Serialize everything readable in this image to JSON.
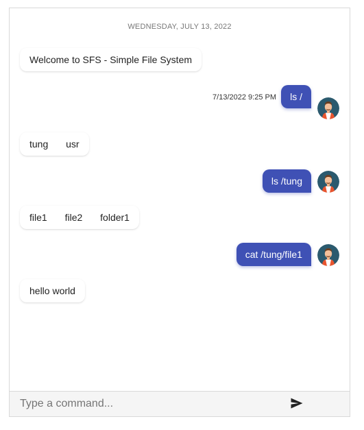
{
  "chat": {
    "date_divider": "WEDNESDAY, JULY 13, 2022",
    "messages": [
      {
        "direction": "incoming",
        "tokens": [
          "Welcome to SFS - Simple File System"
        ]
      },
      {
        "direction": "outgoing",
        "text": "ls /",
        "timestamp": "7/13/2022 9:25 PM"
      },
      {
        "direction": "incoming",
        "tokens": [
          "tung",
          "usr"
        ]
      },
      {
        "direction": "outgoing",
        "text": "ls /tung"
      },
      {
        "direction": "incoming",
        "tokens": [
          "file1",
          "file2",
          "folder1"
        ]
      },
      {
        "direction": "outgoing",
        "text": "cat /tung/file1"
      },
      {
        "direction": "incoming",
        "tokens": [
          "hello world"
        ]
      }
    ]
  },
  "input": {
    "value": "",
    "placeholder": "Type a command..."
  },
  "icons": {
    "send": "send-icon",
    "avatar": "user-avatar"
  },
  "colors": {
    "outgoing_bubble": "#3f51b5",
    "avatar_bg": "#2b5a6e",
    "send_icon": "#222222"
  }
}
